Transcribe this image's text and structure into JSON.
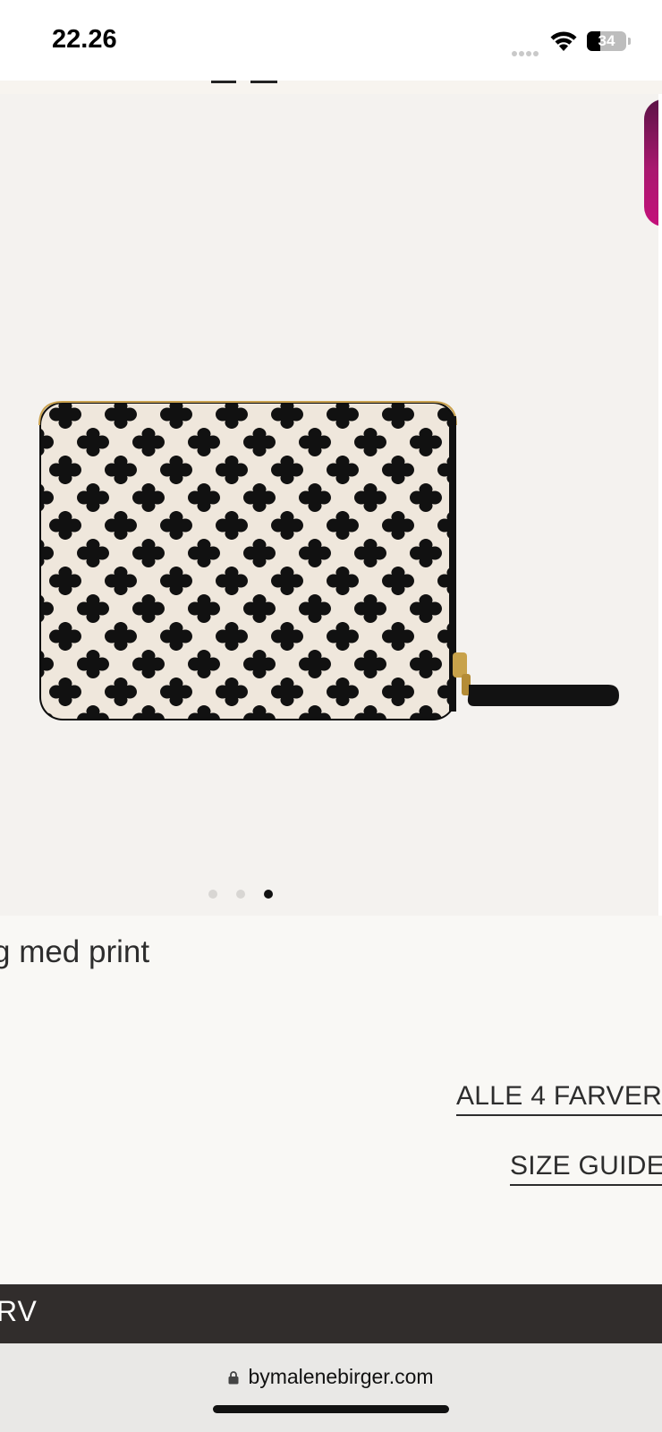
{
  "status_bar": {
    "time": "22.26",
    "battery_level": "34",
    "battery_fraction": 0.34
  },
  "gallery": {
    "image_count": 3,
    "active_index": 2,
    "product_image": "black-white-printed-zip-wallet",
    "pattern_colors": {
      "base": "#111111",
      "print": "#efe7dc",
      "zip": "#c8a24a"
    }
  },
  "product": {
    "title": "g med print",
    "colors_link": "ALLE 4 FARVER",
    "size_guide_link": "SIZE GUIDE"
  },
  "cta": {
    "label": "RV"
  },
  "browser": {
    "url": "bymalenebirger.com",
    "lock_icon": "lock-icon"
  },
  "colors": {
    "cta_background": "#312d2c",
    "page_background": "#f9f8f5",
    "gallery_background": "#f4f2ef",
    "promo_accent": "#a9186f"
  }
}
